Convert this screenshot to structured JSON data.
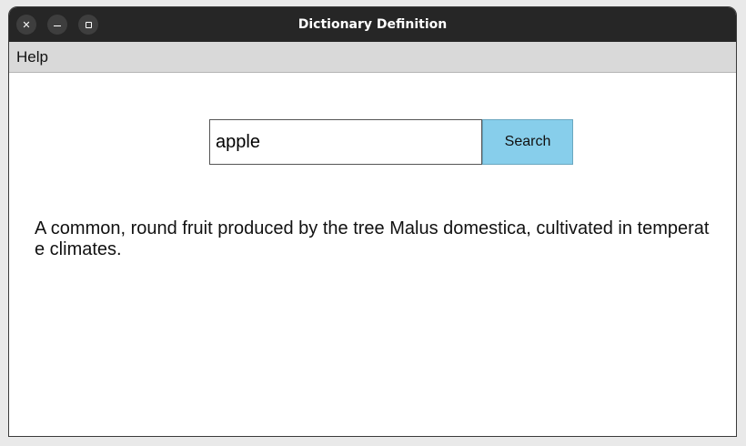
{
  "window": {
    "title": "Dictionary Definition"
  },
  "menu": {
    "items": [
      {
        "label": "Help"
      }
    ]
  },
  "search": {
    "value": "apple",
    "button_label": "Search"
  },
  "result": {
    "definition": "A common, round fruit produced by the tree Malus domestica, cultivated in temperate climates."
  },
  "icons": {
    "close": "close-icon",
    "minimize": "minimize-icon",
    "maximize": "maximize-icon"
  }
}
